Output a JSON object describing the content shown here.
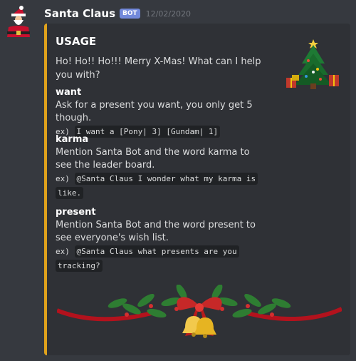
{
  "message": {
    "author": "Santa Claus",
    "bot_tag": "BOT",
    "timestamp": "12/02/2020"
  },
  "embed": {
    "title": "USAGE",
    "description": "Ho! Ho!! Ho!!! Merry X-Mas! What can I help you with?",
    "accent_color": "#e0a21c",
    "fields": [
      {
        "name": "want",
        "value": "Ask for a present you want, you only get 5 though.",
        "example_prefix": "ex)",
        "example_code": "I want a [Pony| 3] [Gundam| 1]"
      },
      {
        "name": "karma",
        "value": "Mention Santa Bot and the word karma to see the leader board.",
        "example_prefix": "ex)",
        "example_code": "@Santa Claus I wonder what my karma is like."
      },
      {
        "name": "present",
        "value": "Mention Santa Bot and the word present to see everyone's wish list.",
        "example_prefix": "ex)",
        "example_code": "@Santa Claus what presents are you tracking?"
      }
    ],
    "thumbnail_icon": "christmas-tree-icon",
    "image_icon": "christmas-garland-with-bells"
  },
  "colors": {
    "background": "#36393f",
    "embed_background": "#2f3136",
    "bot_tag": "#7289da"
  }
}
